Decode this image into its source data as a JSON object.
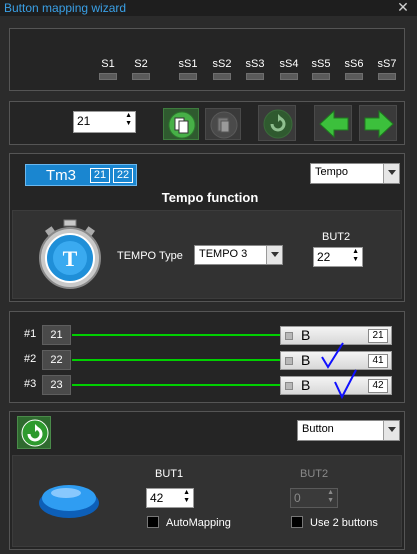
{
  "window": {
    "title": "Button mapping wizard",
    "close_glyph": "✕"
  },
  "switches": [
    "S1",
    "S2",
    "sS1",
    "sS2",
    "sS3",
    "sS4",
    "sS5",
    "sS6",
    "sS7"
  ],
  "toolbar": {
    "number_value": "21"
  },
  "tempo": {
    "tab_label": "Tm3",
    "tab_badges": [
      "21",
      "22"
    ],
    "mode_select": "Tempo",
    "heading": "Tempo function",
    "type_label": "TEMPO Type",
    "type_value": "TEMPO 3",
    "but2_label": "BUT2",
    "but2_value": "22"
  },
  "mapping_rows": [
    {
      "label": "#1",
      "num": "21",
      "slot_text": "B",
      "slot_num": "21"
    },
    {
      "label": "#2",
      "num": "22",
      "slot_text": "B",
      "slot_num": "41"
    },
    {
      "label": "#3",
      "num": "23",
      "slot_text": "B",
      "slot_num": "42"
    }
  ],
  "button_section": {
    "mode_select": "Button",
    "but1_label": "BUT1",
    "but1_value": "42",
    "but2_label": "BUT2",
    "but2_value": "0",
    "automapping_label": "AutoMapping",
    "use2_label": "Use 2 buttons"
  },
  "colors": {
    "accent_blue": "#1a86d0",
    "line_green": "#00d000",
    "title_blue": "#3aa0e6",
    "annotation_blue": "#1010ff"
  }
}
